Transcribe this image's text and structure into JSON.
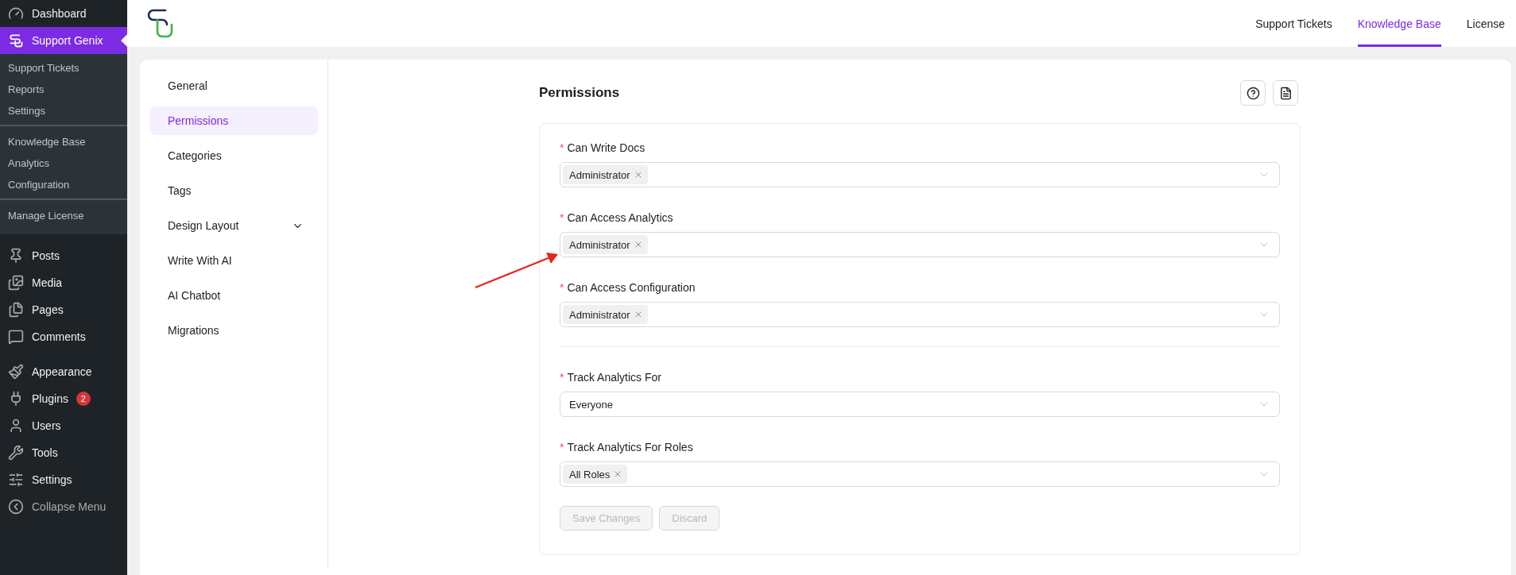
{
  "admin_menu": [
    {
      "label": "Dashboard",
      "selected": false
    },
    {
      "label": "Support Genix",
      "selected": true,
      "submenu_groups": [
        [
          {
            "label": "Support Tickets"
          },
          {
            "label": "Reports"
          },
          {
            "label": "Settings"
          }
        ],
        [
          {
            "label": "Knowledge Base"
          },
          {
            "label": "Analytics"
          },
          {
            "label": "Configuration"
          }
        ],
        [
          {
            "label": "Manage License"
          }
        ]
      ]
    },
    {
      "label": "Posts",
      "selected": false
    },
    {
      "label": "Media",
      "selected": false
    },
    {
      "label": "Pages",
      "selected": false
    },
    {
      "label": "Comments",
      "selected": false
    },
    {
      "label": "Appearance",
      "selected": false
    },
    {
      "label": "Plugins",
      "selected": false,
      "badge": "2"
    },
    {
      "label": "Users",
      "selected": false
    },
    {
      "label": "Tools",
      "selected": false
    },
    {
      "label": "Settings",
      "selected": false
    },
    {
      "label": "Collapse Menu",
      "selected": false
    }
  ],
  "top_nav": [
    {
      "label": "Support Tickets",
      "selected": false
    },
    {
      "label": "Knowledge Base",
      "selected": true
    },
    {
      "label": "License",
      "selected": false
    }
  ],
  "settings_nav": [
    {
      "label": "General",
      "selected": false
    },
    {
      "label": "Permissions",
      "selected": true
    },
    {
      "label": "Categories",
      "selected": false
    },
    {
      "label": "Tags",
      "selected": false
    },
    {
      "label": "Design Layout",
      "selected": false,
      "expanded": false
    },
    {
      "label": "Write With AI",
      "selected": false
    },
    {
      "label": "AI Chatbot",
      "selected": false
    },
    {
      "label": "Migrations",
      "selected": false
    }
  ],
  "page_title": "Permissions",
  "required_mark": "*",
  "form_sections": [
    [
      {
        "label": "Can Write Docs",
        "required": true,
        "kind": "tags",
        "values": [
          "Administrator"
        ]
      },
      {
        "label": "Can Access Analytics",
        "required": true,
        "kind": "tags",
        "values": [
          "Administrator"
        ]
      },
      {
        "label": "Can Access Configuration",
        "required": true,
        "kind": "tags",
        "values": [
          "Administrator"
        ]
      }
    ],
    [
      {
        "label": "Track Analytics For",
        "required": true,
        "kind": "select",
        "value": "Everyone"
      },
      {
        "label": "Track Analytics For Roles",
        "required": true,
        "kind": "tags",
        "values": [
          "All Roles"
        ]
      }
    ]
  ],
  "buttons": [
    {
      "label": "Save Changes",
      "disabled": true
    },
    {
      "label": "Discard",
      "disabled": true
    }
  ]
}
